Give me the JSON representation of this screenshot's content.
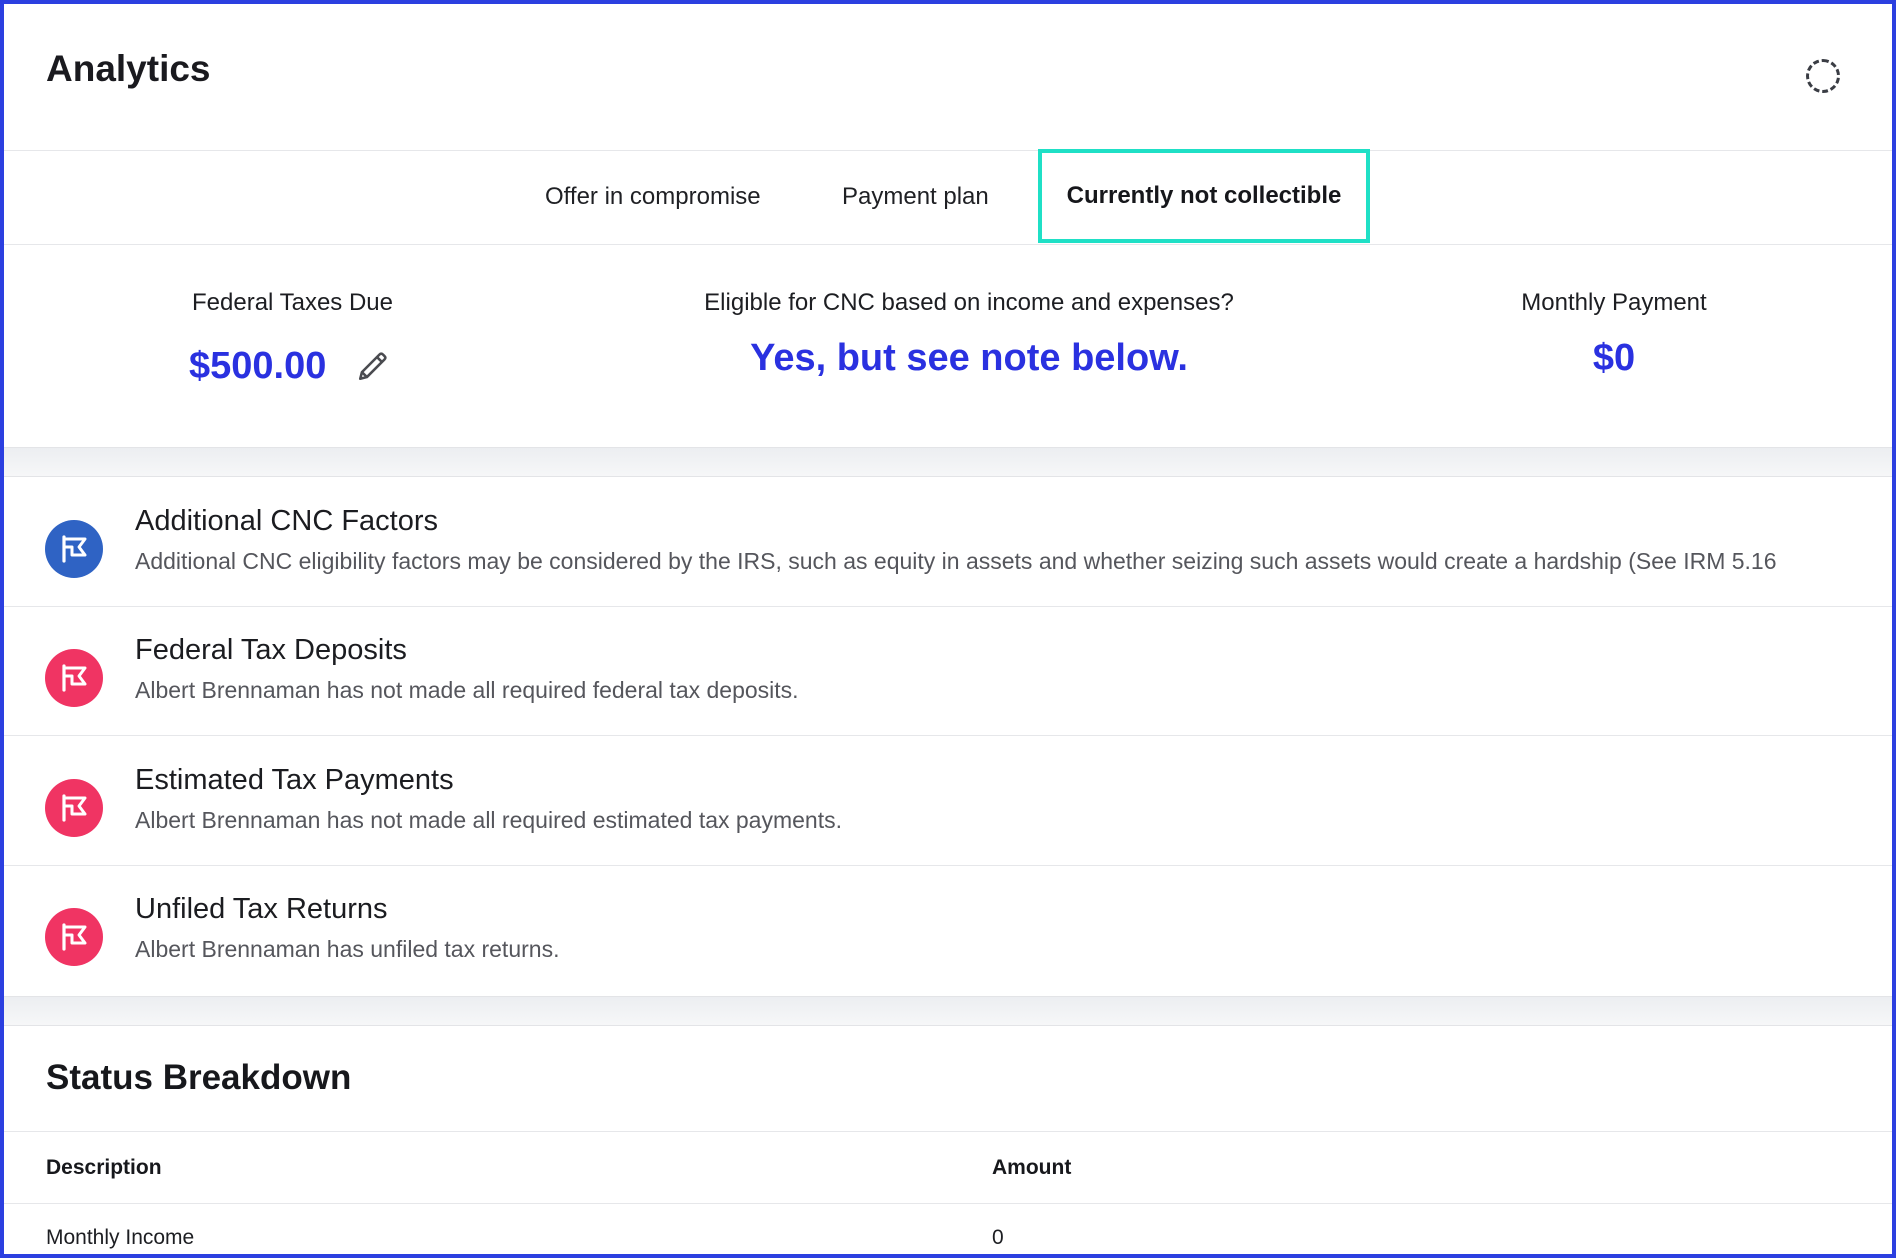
{
  "header": {
    "title": "Analytics",
    "loading_icon": "spinner-icon"
  },
  "tabs": [
    {
      "label": "Offer in compromise",
      "active": false
    },
    {
      "label": "Payment plan",
      "active": false
    },
    {
      "label": "Currently not collectible",
      "active": true
    }
  ],
  "summary": {
    "federal_taxes_due": {
      "label": "Federal Taxes Due",
      "value": "$500.00",
      "edit_icon": "pencil-icon"
    },
    "eligibility": {
      "label": "Eligible for CNC based on income and expenses?",
      "value": "Yes, but see note below."
    },
    "monthly_payment": {
      "label": "Monthly Payment",
      "value": "$0"
    }
  },
  "factors": [
    {
      "title": "Additional CNC Factors",
      "description": "Additional CNC eligibility factors may be considered by the IRS, such as equity in assets and whether seizing such assets would create a hardship (See IRM 5.16",
      "icon": "flag-icon",
      "color": "#2f63c4"
    },
    {
      "title": "Federal Tax Deposits",
      "description": "Albert Brennaman has not made all required federal tax deposits.",
      "icon": "flag-icon",
      "color": "#f03463"
    },
    {
      "title": "Estimated Tax Payments",
      "description": "Albert Brennaman has not made all required estimated tax payments.",
      "icon": "flag-icon",
      "color": "#f03463"
    },
    {
      "title": "Unfiled Tax Returns",
      "description": "Albert Brennaman has unfiled tax returns.",
      "icon": "flag-icon",
      "color": "#f03463"
    }
  ],
  "status_breakdown": {
    "title": "Status Breakdown",
    "columns": [
      "Description",
      "Amount"
    ],
    "rows": [
      {
        "description": "Monthly Income",
        "amount": "0"
      }
    ]
  },
  "colors": {
    "accent": "#2a31e0",
    "active_tab_border": "#1fe0c6",
    "frame_border": "#2b3fe0"
  }
}
